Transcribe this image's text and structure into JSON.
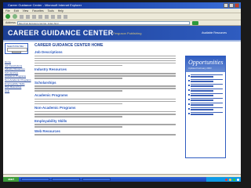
{
  "window": {
    "title": "Career Guidance Center - Microsoft Internet Explorer",
    "controls": [
      "minimize-icon",
      "maximize-icon",
      "close-icon"
    ]
  },
  "menu": [
    "File",
    "Edit",
    "View",
    "Favorites",
    "Tools",
    "Help"
  ],
  "address": {
    "label": "Address",
    "value": "http://cgc.ferguson.com/ca_index.html"
  },
  "site": {
    "title": "CAREER GUIDANCE CENTER",
    "subtitle": "Ferguson Publishing",
    "header_right": "Available Resources"
  },
  "search": {
    "label": "Search this Site"
  },
  "nav": [
    "Home",
    "Job Descriptions",
    "Industry Resources",
    "Scholarships",
    "Academic Programs",
    "Non-Academic Programs",
    "Employability Skills",
    "Web Resources",
    "Help"
  ],
  "main": {
    "heading": "CAREER GUIDANCE CENTER HOME",
    "sections": [
      {
        "title": "Job Descriptions",
        "lines": 5
      },
      {
        "title": "Industry Resources",
        "lines": 3
      },
      {
        "title": "Scholarships",
        "lines": 3
      },
      {
        "title": "Academic Programs",
        "lines": 3
      },
      {
        "title": "Non-Academic Programs",
        "lines": 3
      },
      {
        "title": "Employability Skills",
        "lines": 2
      },
      {
        "title": "Web Resources",
        "lines": 1
      }
    ]
  },
  "opportunities": {
    "title": "Opportunities",
    "subtitle": "Updated February 2003",
    "item_count": 9
  },
  "taskbar": {
    "start": "start",
    "colors": {
      "start": "#3c9c3a",
      "bar": "#2d62d6",
      "tray": "#0f9ae6"
    }
  },
  "colors": {
    "brand": "#1c3f94",
    "accent": "#2f5cc0",
    "highlight": "#d9c57a"
  }
}
